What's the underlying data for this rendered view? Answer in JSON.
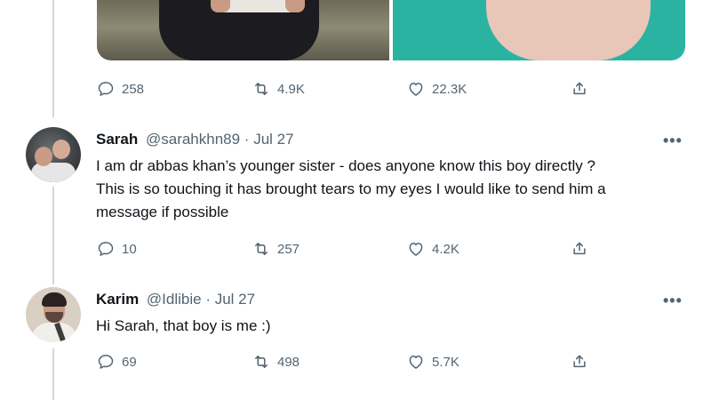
{
  "original_tweet": {
    "stats": {
      "replies": "258",
      "retweets": "4.9K",
      "likes": "22.3K"
    }
  },
  "replies": [
    {
      "display_name": "Sarah",
      "meta": "@sarahkhn89 · Jul 27",
      "text_lines": [
        "I am dr abbas khan’s younger sister - does anyone know this boy directly ?",
        "This is so touching it has brought tears to my eyes I would like to send him a",
        "message if possible"
      ],
      "stats": {
        "replies": "10",
        "retweets": "257",
        "likes": "4.2K"
      }
    },
    {
      "display_name": "Karim",
      "meta": "@Idlibie · Jul 27",
      "text_lines": [
        "Hi Sarah, that boy is me :)"
      ],
      "stats": {
        "replies": "69",
        "retweets": "498",
        "likes": "5.7K"
      }
    }
  ],
  "more_label": "•••",
  "icons": {
    "reply": "reply-icon",
    "retweet": "retweet-icon",
    "like": "heart-icon",
    "share": "share-icon",
    "more": "more-icon"
  },
  "colors": {
    "text": "#0f1419",
    "muted": "#536471",
    "thread_line": "#cfd9de"
  }
}
